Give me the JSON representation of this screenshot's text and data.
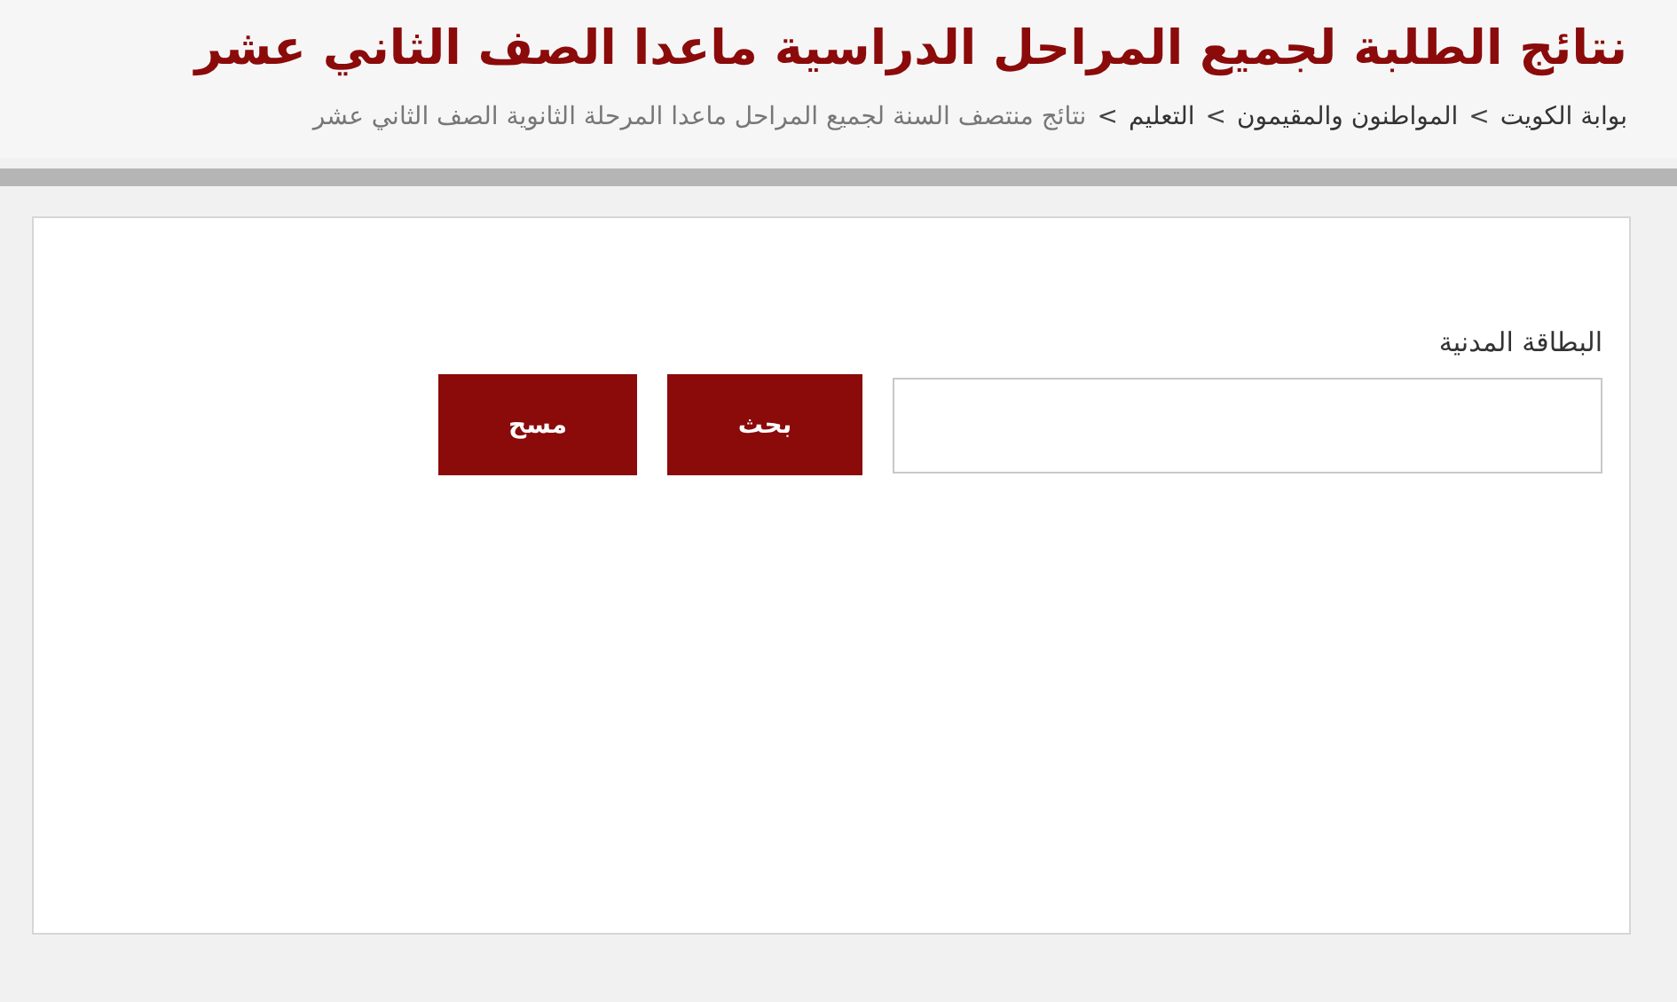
{
  "page": {
    "title": "نتائج الطلبة لجميع المراحل الدراسية ماعدا الصف الثاني عشر"
  },
  "breadcrumb": [
    {
      "kind": "link",
      "text": "بوابة الكويت"
    },
    {
      "kind": "separator",
      "text": ">"
    },
    {
      "kind": "link",
      "text": "المواطنون والمقيمون"
    },
    {
      "kind": "separator",
      "text": ">"
    },
    {
      "kind": "link",
      "text": "التعليم"
    },
    {
      "kind": "separator",
      "text": ">"
    },
    {
      "kind": "current",
      "text": "نتائج منتصف السنة لجميع المراحل ماعدا المرحلة الثانوية الصف الثاني عشر"
    }
  ],
  "form": {
    "field": {
      "label": "البطاقة المدنية"
    },
    "buttons": [
      {
        "label": "بحث"
      },
      {
        "label": "مسح"
      }
    ]
  }
}
